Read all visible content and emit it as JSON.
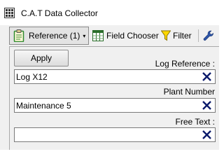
{
  "window": {
    "title": "C.A.T Data Collector",
    "icon": "app-grid-icon"
  },
  "toolbar": {
    "reference": {
      "label": "Reference (1)",
      "icon": "clipboard-icon",
      "caret": "▾"
    },
    "field_chooser": {
      "label": "Field Chooser",
      "icon": "columns-icon"
    },
    "filter": {
      "label": "Filter",
      "icon": "funnel-icon"
    },
    "tools": {
      "icon": "wrench-icon"
    }
  },
  "panel": {
    "apply_label": "Apply",
    "fields": [
      {
        "label": "Log Reference :",
        "value": "Log X12"
      },
      {
        "label": "Plant Number",
        "value": "Maintenance 5"
      },
      {
        "label": "Free Text :",
        "value": ""
      }
    ]
  },
  "colors": {
    "clear_icon": "#0a1a6b",
    "clipboard_icon": "#2f8a2f",
    "columns_icon": "#2a6e2a",
    "funnel_icon": "#e0c000",
    "wrench_icon": "#2d55a8"
  }
}
